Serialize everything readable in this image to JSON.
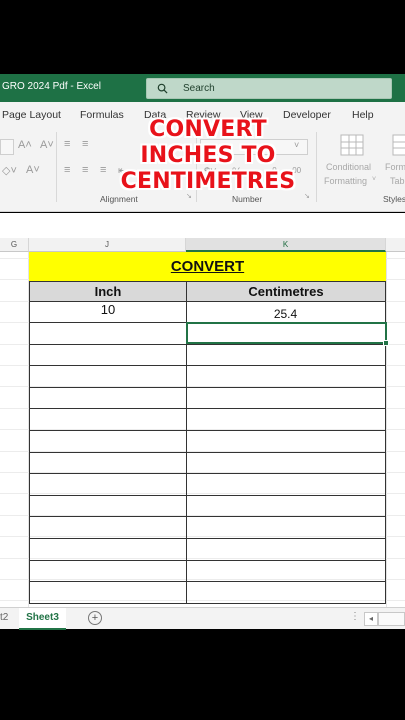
{
  "window": {
    "title": "GRO 2024 Pdf  -  Excel",
    "search_placeholder": "Search"
  },
  "ribbon": {
    "menus": [
      "Page Layout",
      "Formulas",
      "Data",
      "Review",
      "View",
      "Developer",
      "Help"
    ],
    "groups": [
      "Alignment",
      "Number",
      "Styles"
    ],
    "conditional_formatting": [
      "Conditional",
      "Formatting"
    ],
    "format_as_table": [
      "Form",
      "Tab"
    ]
  },
  "overlay": {
    "line1": "CONVERT",
    "line2": "INCHES TO",
    "line3": "CENTIMETRES"
  },
  "sheet": {
    "columns": [
      "G",
      "J",
      "K"
    ],
    "selected_column": "K",
    "title": "CONVERT",
    "headers": [
      "Inch",
      "Centimetres"
    ],
    "rows": [
      [
        "10",
        "25.4"
      ]
    ],
    "empty_rows": 13
  },
  "tabs": {
    "prev_label": "t2",
    "active": "Sheet3",
    "add_label": "+"
  },
  "colors": {
    "excel_green": "#217346",
    "title_fill": "#ffff00",
    "overlay_red": "#e8121a"
  }
}
